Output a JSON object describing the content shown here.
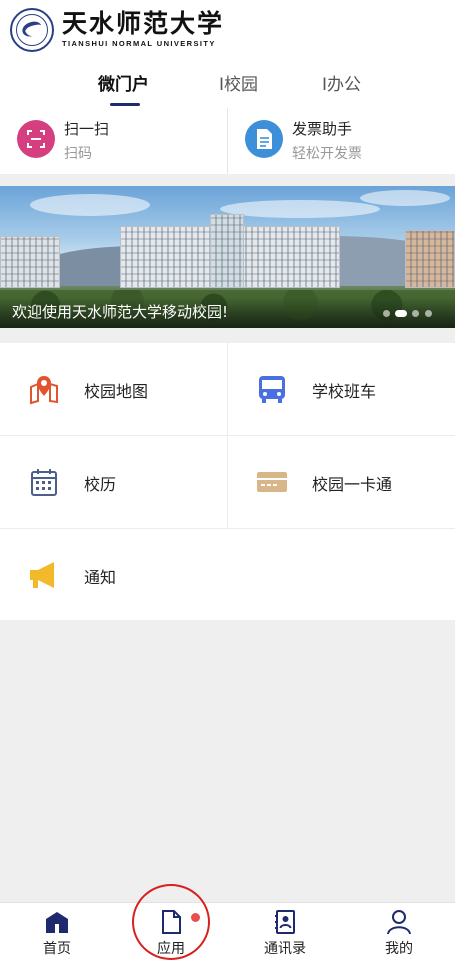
{
  "header": {
    "title": "天水师范大学",
    "subtitle": "TIANSHUI NORMAL UNIVERSITY"
  },
  "tabs": [
    {
      "label": "微门户",
      "active": true
    },
    {
      "label": "I校园",
      "active": false
    },
    {
      "label": "I办公",
      "active": false
    }
  ],
  "quick_actions": [
    {
      "title": "扫一扫",
      "subtitle": "扫码",
      "icon": "scan-icon",
      "color": "#d63f7f"
    },
    {
      "title": "发票助手",
      "subtitle": "轻松开发票",
      "icon": "invoice-icon",
      "color": "#3d8fd9"
    }
  ],
  "banner": {
    "caption": "欢迎使用天水师范大学移动校园!",
    "slides": 4,
    "active_slide": 2
  },
  "apps": [
    {
      "label": "校园地图",
      "icon": "map-pin-icon",
      "color": "#e0552f"
    },
    {
      "label": "学校班车",
      "icon": "bus-icon",
      "color": "#4a6fe0"
    },
    {
      "label": "校历",
      "icon": "calendar-icon",
      "color": "#4b5f8a"
    },
    {
      "label": "校园一卡通",
      "icon": "card-icon",
      "color": "#d9b58a"
    },
    {
      "label": "通知",
      "icon": "megaphone-icon",
      "color": "#f2b92a"
    }
  ],
  "bottom_nav": [
    {
      "label": "首页",
      "icon": "home-icon",
      "active": false
    },
    {
      "label": "应用",
      "icon": "document-icon",
      "active": true,
      "badge": true
    },
    {
      "label": "通讯录",
      "icon": "contacts-icon",
      "active": false
    },
    {
      "label": "我的",
      "icon": "user-icon",
      "active": false
    }
  ],
  "accent": "#1f2a6e",
  "annotation_color": "#d8201f"
}
